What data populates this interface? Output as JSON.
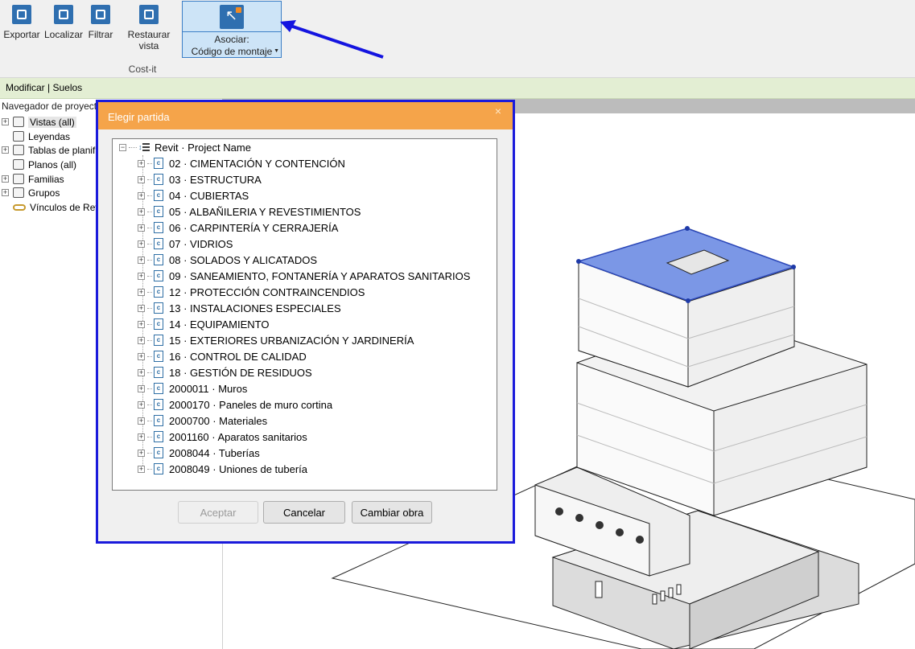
{
  "ribbon": {
    "buttons": [
      {
        "label": "Exportar",
        "icon": "export-icon"
      },
      {
        "label": "Localizar",
        "icon": "locate-icon"
      },
      {
        "label": "Filtrar",
        "icon": "filter-icon"
      },
      {
        "label": "Restaurar vista",
        "icon": "restore-view-icon"
      }
    ],
    "asociar": {
      "line1": "Asociar:",
      "line2": "Código de montaje",
      "icon": "associate-cursor-icon"
    },
    "panel_label": "Cost-it"
  },
  "context_bar": {
    "label": "Modificar | Suelos"
  },
  "browser": {
    "title": "Navegador de proyecto",
    "items": [
      {
        "label": "Vistas (all)",
        "expandable": true,
        "selected": true
      },
      {
        "label": "Leyendas",
        "expandable": false
      },
      {
        "label": "Tablas de planificación",
        "expandable": true
      },
      {
        "label": "Planos (all)",
        "expandable": false
      },
      {
        "label": "Familias",
        "expandable": true
      },
      {
        "label": "Grupos",
        "expandable": true
      },
      {
        "label": "Vínculos de Revit",
        "expandable": false
      }
    ]
  },
  "dialog": {
    "title": "Elegir partida",
    "close_glyph": "×",
    "tree_root": "Revit · Project Name",
    "tree_items": [
      "02 · CIMENTACIÓN Y CONTENCIÓN",
      "03 · ESTRUCTURA",
      "04 · CUBIERTAS",
      "05 · ALBAÑILERIA Y REVESTIMIENTOS",
      "06 · CARPINTERÍA Y CERRAJERÍA",
      "07 · VIDRIOS",
      "08 · SOLADOS Y ALICATADOS",
      "09 · SANEAMIENTO, FONTANERÍA Y APARATOS SANITARIOS",
      "12 · PROTECCIÓN CONTRAINCENDIOS",
      "13 · INSTALACIONES ESPECIALES",
      "14 · EQUIPAMIENTO",
      "15 · EXTERIORES URBANIZACIÓN Y JARDINERÍA",
      "16 · CONTROL DE CALIDAD",
      "18 · GESTIÓN DE RESIDUOS",
      "2000011 · Muros",
      "2000170 · Paneles de muro cortina",
      "2000700 · Materiales",
      "2001160 · Aparatos sanitarios",
      "2008044 · Tuberías",
      "2008049 · Uniones de tubería"
    ],
    "buttons": {
      "accept": "Aceptar",
      "cancel": "Cancelar",
      "change": "Cambiar obra"
    },
    "accept_enabled": false
  },
  "colors": {
    "dialog_title_bar": "#f5a44a",
    "highlight": "#1a1adb",
    "selected_floor": "#7b97e6"
  }
}
